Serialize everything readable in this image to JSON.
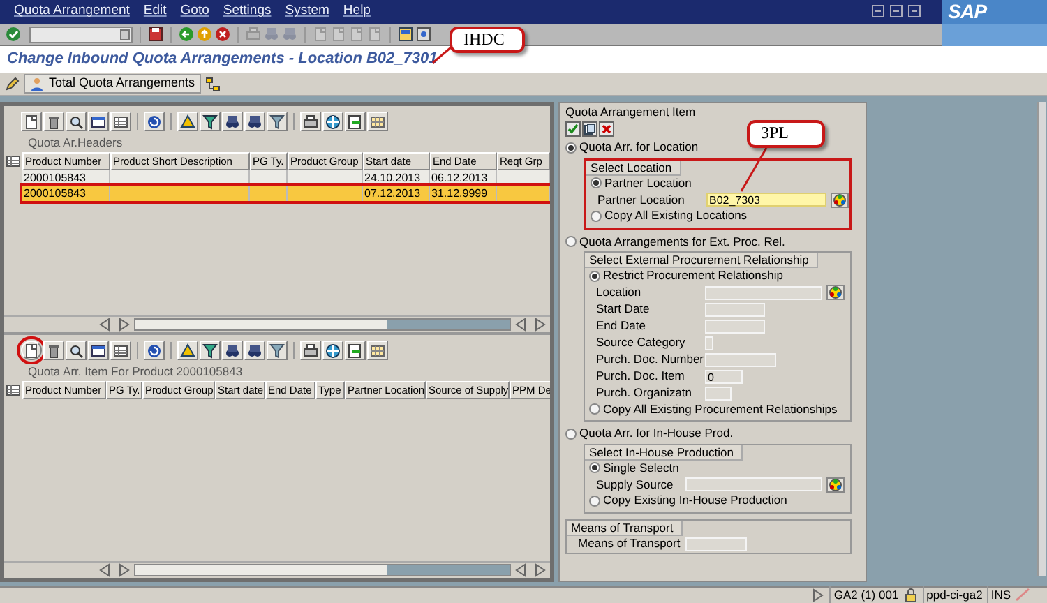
{
  "menu": [
    "Quota Arrangement",
    "Edit",
    "Goto",
    "Settings",
    "System",
    "Help"
  ],
  "logo": "SAP",
  "title": "Change Inbound Quota Arrangements - Location B02_7301",
  "app_toolbar": {
    "button": "Total Quota Arrangements"
  },
  "callouts": [
    {
      "text": "IHDC"
    },
    {
      "text": "3PL"
    }
  ],
  "headers_table": {
    "caption": "Quota Ar.Headers",
    "columns": [
      "Product Number",
      "Product Short Description",
      "PG Ty.",
      "Product Group",
      "Start date",
      "End Date",
      "Reqt Grp"
    ],
    "rows": [
      {
        "product_number": "2000105843",
        "start_date": "24.10.2013",
        "end_date": "06.12.2013",
        "selected": false,
        "highlighted": false
      },
      {
        "product_number": "2000105843",
        "start_date": "07.12.2013",
        "end_date": "31.12.9999",
        "selected": true,
        "highlighted": true
      }
    ]
  },
  "items_table": {
    "caption": "Quota Arr. Item For Product 2000105843",
    "create_circled": true,
    "columns": [
      "Product Number",
      "PG Ty.",
      "Product Group",
      "Start date",
      "End Date",
      "Type",
      "Partner Location",
      "Source of Supply",
      "PPM De"
    ]
  },
  "item_panel": {
    "title": "Quota Arrangement Item",
    "options": [
      {
        "label": "Quota Arr. for Location",
        "selected": true,
        "group": {
          "title": "Select Location",
          "highlighted": true,
          "rows": [
            {
              "kind": "radio",
              "label": "Partner Location",
              "selected": true
            },
            {
              "kind": "field",
              "label": "Partner Location",
              "value": "B02_7303",
              "focused": true,
              "help": true
            },
            {
              "kind": "radio",
              "label": "Copy All Existing Locations",
              "selected": false
            }
          ]
        }
      },
      {
        "label": "Quota Arrangements for Ext. Proc. Rel.",
        "selected": false,
        "group": {
          "title": "Select External Procurement Relationship",
          "highlighted": false,
          "rows": [
            {
              "kind": "radio",
              "label": "Restrict Procurement Relationship",
              "selected": true
            },
            {
              "kind": "field",
              "label": "Location",
              "help": true
            },
            {
              "kind": "field",
              "label": "Start Date"
            },
            {
              "kind": "field",
              "label": "End Date"
            },
            {
              "kind": "field",
              "label": "Source Category"
            },
            {
              "kind": "field",
              "label": "Purch. Doc. Number"
            },
            {
              "kind": "field",
              "label": "Purch. Doc. Item",
              "value": "0"
            },
            {
              "kind": "field",
              "label": "Purch. Organizatn"
            },
            {
              "kind": "radio",
              "label": "Copy All Existing Procurement Relationships",
              "selected": false
            }
          ]
        }
      },
      {
        "label": "Quota Arr. for In-House Prod.",
        "selected": false,
        "group": {
          "title": "Select In-House Production",
          "highlighted": false,
          "rows": [
            {
              "kind": "radio",
              "label": "Single Selectn",
              "selected": true
            },
            {
              "kind": "field",
              "label": "Supply Source",
              "help": true
            },
            {
              "kind": "radio",
              "label": "Copy Existing In-House Production",
              "selected": false
            }
          ]
        }
      }
    ],
    "transport": {
      "title": "Means of Transport",
      "field_label": "Means of Transport"
    }
  },
  "status_bar": {
    "system": "GA2 (1) 001",
    "server": "ppd-ci-ga2",
    "mode": "INS"
  }
}
